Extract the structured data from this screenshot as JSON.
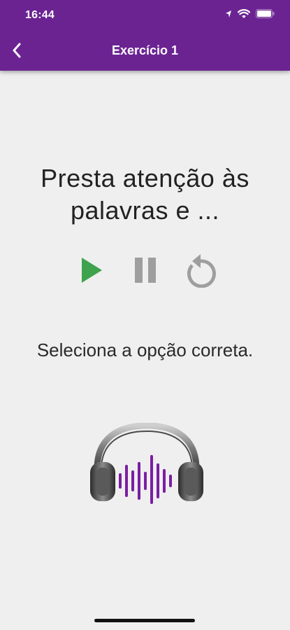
{
  "status_bar": {
    "time": "16:44",
    "icons": [
      "location-arrow-icon",
      "wifi-icon",
      "battery-icon"
    ]
  },
  "header": {
    "title": "Exercício 1",
    "back_icon": "chevron-left-icon",
    "background_color": "#6b2392"
  },
  "exercise": {
    "prompt": "Presta atenção às palavras e ...",
    "controls": [
      {
        "name": "play",
        "icon": "play-icon",
        "color": "#3fa34d"
      },
      {
        "name": "pause",
        "icon": "pause-icon",
        "color": "#9e9e9e"
      },
      {
        "name": "replay",
        "icon": "replay-icon",
        "color": "#9e9e9e"
      }
    ],
    "instruction": "Seleciona a opção correta.",
    "illustration_icon": "headphones-soundwave-icon",
    "wave_color": "#7a1fa2"
  }
}
